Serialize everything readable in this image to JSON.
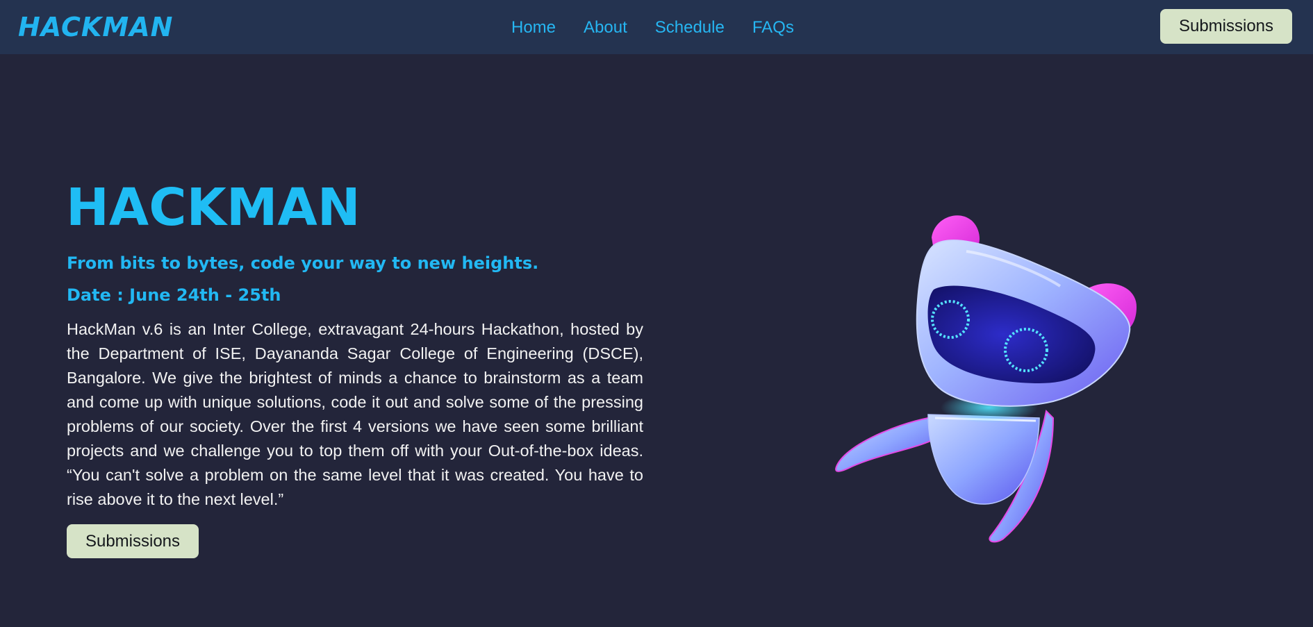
{
  "header": {
    "logo_text": "HACKMAN",
    "nav": [
      {
        "label": "Home"
      },
      {
        "label": "About"
      },
      {
        "label": "Schedule"
      },
      {
        "label": "FAQs"
      }
    ],
    "submit_label": "Submissions"
  },
  "hero": {
    "title": "HACKMAN",
    "tagline": "From bits to bytes, code your way to new heights.",
    "date": "Date : June 24th - 25th",
    "description": "HackMan v.6 is an Inter College, extravagant 24-hours Hackathon, hosted by the Department of ISE, Dayananda Sagar College of Engineering (DSCE), Bangalore. We give the brightest of minds a chance to brainstorm as a team and come up with unique solutions, code it out and solve some of the pressing problems of our society. Over the first 4 versions we have seen some brilliant projects and we challenge you to top them off with your Out-of-the-box ideas. “You can't solve a problem on the same level that it was created. You have to rise above it to the next level.”",
    "button_label": "Submissions"
  },
  "colors": {
    "background": "#23253a",
    "navbar": "#243350",
    "accent": "#1fbdf4",
    "button": "#d6e3c7"
  },
  "icons": {
    "mascot": "robot-mascot-illustration"
  }
}
